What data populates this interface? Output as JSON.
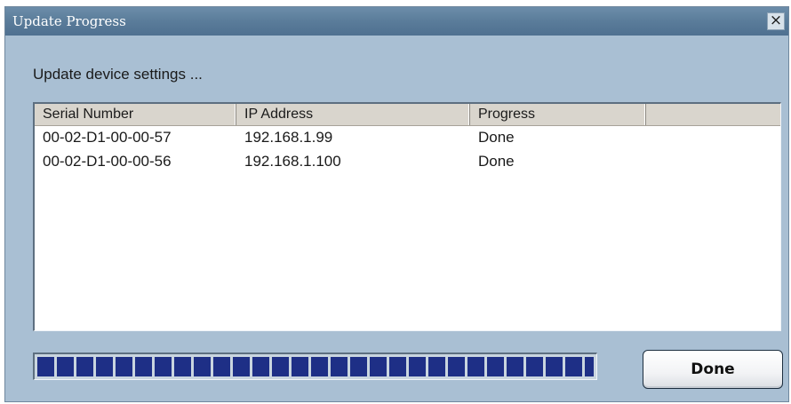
{
  "window": {
    "title": "Update Progress",
    "close_glyph": "×",
    "close_icon": "close-icon"
  },
  "status_text": "Update device settings ...",
  "list": {
    "columns": [
      "Serial Number",
      "IP Address",
      "Progress",
      ""
    ],
    "rows": [
      {
        "serial": "00-02-D1-00-00-57",
        "ip": "192.168.1.99",
        "progress": "Done"
      },
      {
        "serial": "00-02-D1-00-00-56",
        "ip": "192.168.1.100",
        "progress": "Done"
      }
    ]
  },
  "progress": {
    "fraction": 1.0,
    "color": "#1e2f86"
  },
  "buttons": {
    "done_label": "Done"
  },
  "colors": {
    "window_bg": "#a9bfd3",
    "titlebar": "#5a7c9a"
  }
}
